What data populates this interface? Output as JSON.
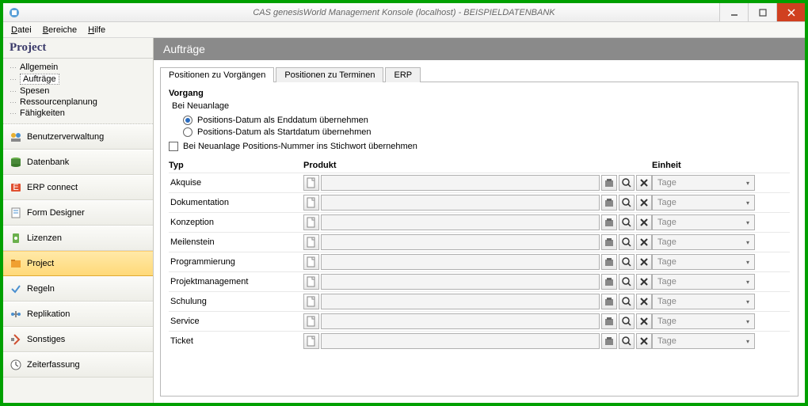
{
  "window": {
    "title": "CAS genesisWorld Management Konsole (localhost) - BEISPIELDATENBANK"
  },
  "menu": {
    "datei": "Datei",
    "bereiche": "Bereiche",
    "hilfe": "Hilfe"
  },
  "sidebar": {
    "header": "Project",
    "tree": [
      "Allgemein",
      "Aufträge",
      "Spesen",
      "Ressourcenplanung",
      "Fähigkeiten"
    ],
    "tree_selected": 1,
    "nav": [
      {
        "label": "Benutzerverwaltung"
      },
      {
        "label": "Datenbank"
      },
      {
        "label": "ERP connect"
      },
      {
        "label": "Form Designer"
      },
      {
        "label": "Lizenzen"
      },
      {
        "label": "Project"
      },
      {
        "label": "Regeln"
      },
      {
        "label": "Replikation"
      },
      {
        "label": "Sonstiges"
      },
      {
        "label": "Zeiterfassung"
      }
    ],
    "nav_active": 5
  },
  "main": {
    "title": "Aufträge",
    "tabs": [
      "Positionen zu Vorgängen",
      "Positionen zu Terminen",
      "ERP"
    ],
    "tab_active": 0,
    "section_heading": "Vorgang",
    "subheading": "Bei Neuanlage",
    "radio1": "Positions-Datum als Enddatum übernehmen",
    "radio2": "Positions-Datum als Startdatum übernehmen",
    "radio_selected": 0,
    "checkbox_label": "Bei Neuanlage Positions-Nummer ins Stichwort übernehmen",
    "checkbox_checked": false,
    "col_typ": "Typ",
    "col_produkt": "Produkt",
    "col_einheit": "Einheit",
    "rows": [
      {
        "typ": "Akquise",
        "einheit": "Tage"
      },
      {
        "typ": "Dokumentation",
        "einheit": "Tage"
      },
      {
        "typ": "Konzeption",
        "einheit": "Tage"
      },
      {
        "typ": "Meilenstein",
        "einheit": "Tage"
      },
      {
        "typ": "Programmierung",
        "einheit": "Tage"
      },
      {
        "typ": "Projektmanagement",
        "einheit": "Tage"
      },
      {
        "typ": "Schulung",
        "einheit": "Tage"
      },
      {
        "typ": "Service",
        "einheit": "Tage"
      },
      {
        "typ": "Ticket",
        "einheit": "Tage"
      }
    ]
  }
}
